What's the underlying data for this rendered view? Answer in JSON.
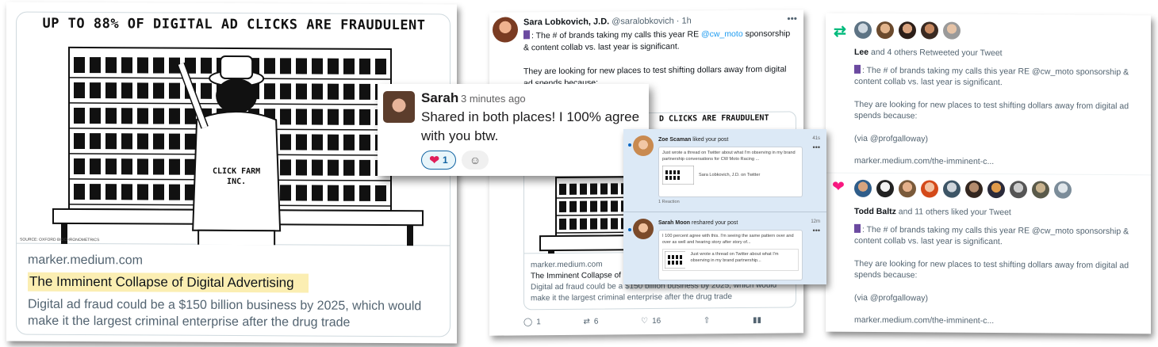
{
  "link_card": {
    "headline": "UP TO 88% OF DIGITAL AD CLICKS ARE FRAUDULENT",
    "sign_text": "CLICK FARM INC.",
    "credit": "SOURCE: OXFORD BIOCHRONOMETRICS",
    "domain": "marker.medium.com",
    "title": "The Imminent Collapse of Digital Advertising",
    "description": "Digital ad fraud could be a $150 billion business by 2025, which would make it the largest criminal enterprise after the drug trade"
  },
  "tweet": {
    "author_name": "Sara Lobkovich, J.D.",
    "author_handle": "@saralobkovich · 1h",
    "body_prefix": ": The # of brands taking my calls this year RE ",
    "mention": "@cw_moto",
    "body_suffix": " sponsorship & content collab vs. last year is significant.",
    "body_line2": "They are looking for new places to test shifting dollars away from digital ad spends because:",
    "card_headline": "D CLICKS ARE FRAUDULENT",
    "card_domain": "marker.medium.com",
    "card_title": "The Imminent Collapse of Digital Advertising",
    "card_description": "Digital ad fraud could be a $150 billion business by 2025, which would make it the largest criminal enterprise after the drug trade",
    "replies": "1",
    "retweets": "6",
    "likes": "16",
    "more_icon": "more-icon"
  },
  "slack": {
    "name": "Sarah",
    "time": "3 minutes ago",
    "message": "Shared in both places! I 100% agree with you btw.",
    "reaction_count": "1",
    "reaction_color": "#1264a3"
  },
  "linkedin": {
    "n1": {
      "name": "Zoe Scaman",
      "action": "liked your post",
      "time": "41s",
      "snippet": "Just wrote a thread on Twitter about what I'm observing in my brand partnership conversations for CW Moto Racing ...",
      "shared_label": "Sara Lobkovich, J.D. on Twitter",
      "reactions": "1 Reaction"
    },
    "n2": {
      "name": "Sarah Moon",
      "action": "reshared your post",
      "time": "12m",
      "snippet": "I 100 percent agree with this. I'm seeing the same pattern over and over as well and hearing story after story of...",
      "quoted": "Just wrote a thread on Twitter about what I'm observing in my brand partnership..."
    },
    "accent": "#0a66c2"
  },
  "notifications": {
    "retweet": {
      "actor": "Lee",
      "summary": " and 4 others Retweeted your Tweet",
      "text1": ": The # of brands taking my calls this year RE @cw_moto sponsorship & content collab vs. last year is significant.",
      "text2": "They are looking for new places to test shifting dollars away from digital ad spends because:",
      "text3": "(via @profgalloway)",
      "link": "marker.medium.com/the-imminent-c..."
    },
    "like": {
      "actor": "Todd Baltz",
      "summary": " and 11 others liked your Tweet",
      "text1": ": The # of brands taking my calls this year RE @cw_moto sponsorship & content collab vs. last year is significant.",
      "text2": "They are looking for new places to test shifting dollars away from digital ad spends because:",
      "text3": "(via @profgalloway)",
      "link": "marker.medium.com/the-imminent-c..."
    },
    "retweet_color": "#00ba7c",
    "like_color": "#f91880"
  }
}
